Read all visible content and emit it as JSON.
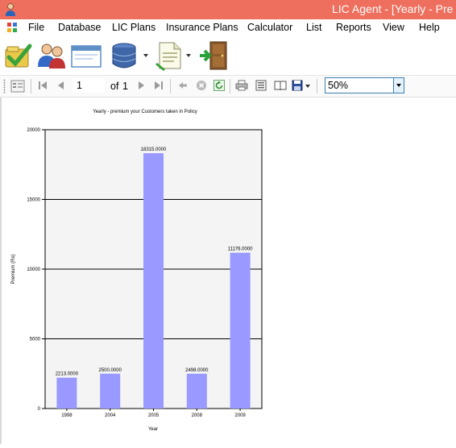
{
  "window": {
    "title": "LIC Agent - [Yearly - Pre"
  },
  "menu": {
    "items": [
      "File",
      "Database",
      "LIC Plans",
      "Insurance Plans",
      "Calculator",
      "List",
      "Reports",
      "View",
      "Help"
    ]
  },
  "toolbar": {
    "buttons": [
      "approve-button",
      "users-button",
      "window-button",
      "database-button",
      "document-button",
      "exit-button"
    ]
  },
  "report_toolbar": {
    "current_page": "1",
    "of_label": "of",
    "total_pages": "1",
    "zoom": "50%"
  },
  "colors": {
    "titlebar": "#ef6f5e",
    "bar": "#9999ff",
    "plot_bg": "#f4f4f4"
  },
  "chart_data": {
    "type": "bar",
    "title": "Yearly - premium your Customers taken in Policy",
    "xlabel": "Year",
    "ylabel": "Premium (Rs)",
    "categories": [
      "1998",
      "2004",
      "2005",
      "2008",
      "2009"
    ],
    "values": [
      2213,
      2500,
      18315,
      2498,
      11176
    ],
    "data_labels": [
      "2213.0000",
      "2500.0000",
      "18315.0000",
      "2498.0000",
      "11176.0000"
    ],
    "ylim": [
      0,
      20000
    ],
    "yticks": [
      "0",
      "5000",
      "10000",
      "15000",
      "20000"
    ],
    "grid": true,
    "legend": "none"
  }
}
